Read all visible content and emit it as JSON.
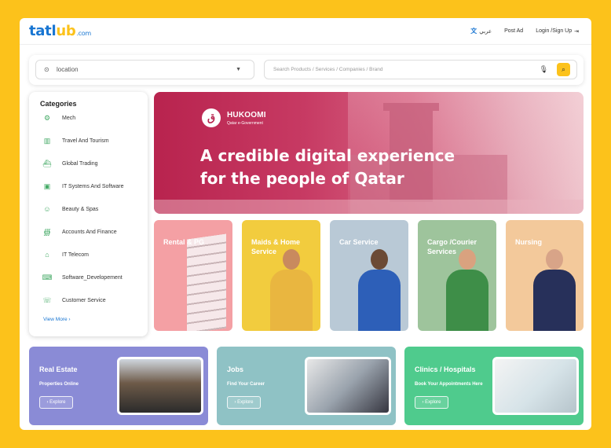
{
  "header": {
    "logo_main": "tatl",
    "logo_accent": "ub",
    "logo_suffix": ".com",
    "lang_icon": "language-icon",
    "lang_label": "عربي",
    "post_ad": "Post Ad",
    "login": "Login /Sign Up"
  },
  "search": {
    "location_placeholder": "location",
    "query_placeholder": "Search Products / Services / Companies / Brand"
  },
  "categories": {
    "title": "Categories",
    "items": [
      {
        "label": "Mech",
        "icon": "gear-icon"
      },
      {
        "label": "Travel And Tourism",
        "icon": "building-icon"
      },
      {
        "label": "Global Trading",
        "icon": "ship-icon"
      },
      {
        "label": "IT Systems And Software",
        "icon": "chip-icon"
      },
      {
        "label": "Beauty & Spas",
        "icon": "face-icon"
      },
      {
        "label": "Accounts And Finance",
        "icon": "finance-icon"
      },
      {
        "label": "IT Telecom",
        "icon": "tower-icon"
      },
      {
        "label": "Software_Developement",
        "icon": "code-icon"
      },
      {
        "label": "Customer Service",
        "icon": "headset-icon"
      }
    ],
    "view_more": "View More"
  },
  "hero": {
    "brand": "HUKOOMI",
    "brand_sub": "Qatar e-Government",
    "headline_1": "A credible digital experience",
    "headline_2": "for the people of Qatar"
  },
  "tiles": [
    {
      "label": "Rental & PG",
      "color": "#F4A0A4"
    },
    {
      "label": "Maids & Home Service",
      "color": "#F2CC3E"
    },
    {
      "label": "Car Service",
      "color": "#B9C9D6"
    },
    {
      "label": "Cargo /Courier Services",
      "color": "#9EC49C"
    },
    {
      "label": "Nursing",
      "color": "#F3C99B"
    }
  ],
  "banners": [
    {
      "title": "Real Estate",
      "subtitle": "Properties Online",
      "button": "Explore",
      "color": "#8A8BD6"
    },
    {
      "title": "Jobs",
      "subtitle": "Find Your Career",
      "button": "Explore",
      "color": "#8FC2C5"
    },
    {
      "title": "Clinics / Hospitals",
      "subtitle": "Book Your Appointments Here",
      "button": "Explore",
      "color": "#4FCB8D"
    }
  ],
  "colors": {
    "accent": "#FCC21B",
    "brand_blue": "#1976d2",
    "hero": "#b8234e"
  }
}
